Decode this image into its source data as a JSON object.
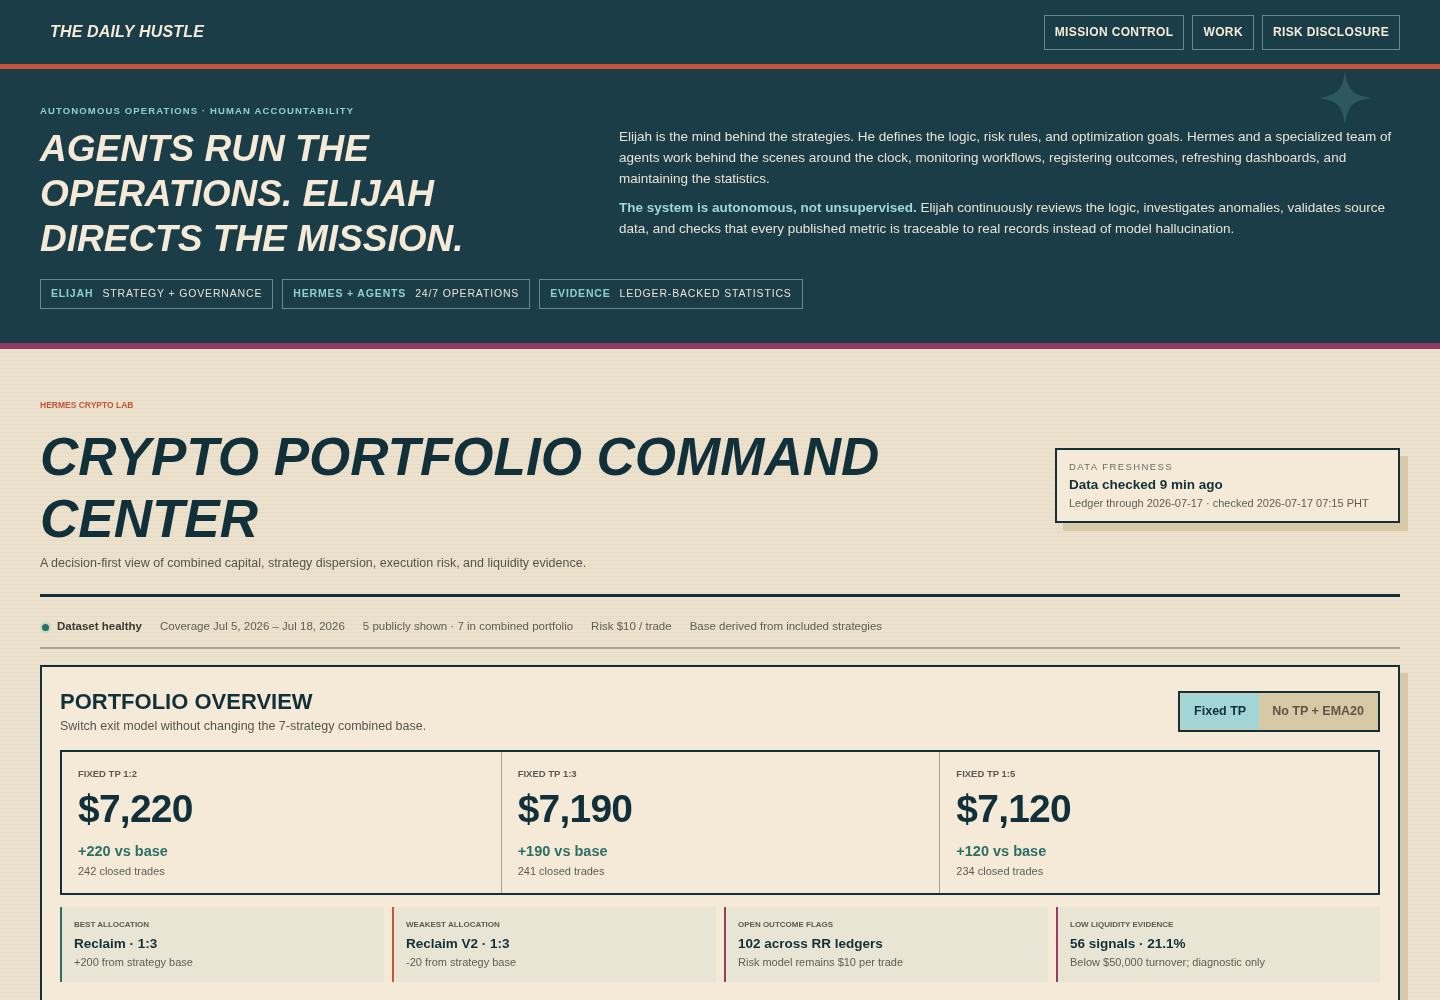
{
  "header": {
    "logo": "THE DAILY HUSTLE",
    "nav": [
      "MISSION CONTROL",
      "WORK",
      "RISK DISCLOSURE"
    ]
  },
  "hero": {
    "eyebrow": "AUTONOMOUS OPERATIONS · HUMAN ACCOUNTABILITY",
    "headline": "AGENTS RUN THE OPERATIONS. ELIJAH DIRECTS THE MISSION.",
    "tags": [
      {
        "label": "ELIJAH",
        "value": "STRATEGY + GOVERNANCE"
      },
      {
        "label": "HERMES + AGENTS",
        "value": "24/7 OPERATIONS"
      },
      {
        "label": "EVIDENCE",
        "value": "LEDGER-BACKED STATISTICS"
      }
    ],
    "paragraphs": [
      "Elijah is the mind behind the strategies. He defines the logic, risk rules, and optimization goals. Hermes and a specialized team of agents work behind the scenes around the clock, monitoring workflows, registering outcomes, refreshing dashboards, and maintaining the statistics.",
      "**The system is autonomous, not unsupervised.** Elijah continuously reviews the logic, investigates anomalies, validates source data, and checks that every published metric is traceable to real records instead of model hallucination."
    ]
  },
  "page": {
    "eyebrow": "HERMES CRYPTO LAB",
    "title": "CRYPTO PORTFOLIO COMMAND CENTER",
    "subtitle": "A decision-first view of combined capital, strategy dispersion, execution risk, and liquidity evidence."
  },
  "freshness": {
    "label": "DATA FRESHNESS",
    "headline": "Data checked 9 min ago",
    "detail": "Ledger through 2026-07-17 · checked 2026-07-17 07:15 PHT"
  },
  "status_bar": [
    {
      "kind": "status",
      "text": "Dataset healthy",
      "color": "#2b6e66"
    },
    {
      "kind": "text",
      "text": "Coverage Jul 5, 2026 – Jul 18, 2026"
    },
    {
      "kind": "text",
      "text": "5 publicly shown · 7 in combined portfolio"
    },
    {
      "kind": "text",
      "text": "Risk $10 / trade"
    },
    {
      "kind": "text",
      "text": "Base derived from included strategies"
    }
  ],
  "overview": {
    "title": "PORTFOLIO OVERVIEW",
    "subtitle": "Switch exit model without changing the 7-strategy combined base.",
    "exit_models": [
      {
        "label": "Fixed TP",
        "selected": true
      },
      {
        "label": "No TP + EMA20",
        "selected": false
      }
    ],
    "metrics": [
      {
        "label": "FIXED TP 1:2",
        "value": "$7,220",
        "delta": "+220 vs base",
        "trades": "242 closed trades"
      },
      {
        "label": "FIXED TP 1:3",
        "value": "$7,190",
        "delta": "+190 vs base",
        "trades": "241 closed trades"
      },
      {
        "label": "FIXED TP 1:5",
        "value": "$7,120",
        "delta": "+120 vs base",
        "trades": "234 closed trades"
      }
    ],
    "flags": [
      {
        "label": "BEST ALLOCATION",
        "value": "Reclaim · 1:3",
        "detail": "+200 from strategy base",
        "color": "#2b6e66"
      },
      {
        "label": "WEAKEST ALLOCATION",
        "value": "Reclaim V2 · 1:3",
        "detail": "-20 from strategy base",
        "color": "#c4553a"
      },
      {
        "label": "OPEN OUTCOME FLAGS",
        "value": "102 across RR ledgers",
        "detail": "Risk model remains $10 per trade",
        "color": "#9a3a66"
      },
      {
        "label": "LOW LIQUIDITY EVIDENCE",
        "value": "56 signals · 21.1%",
        "detail": "Below $50,000 turnover; diagnostic only",
        "color": "#9a3a66"
      }
    ]
  }
}
